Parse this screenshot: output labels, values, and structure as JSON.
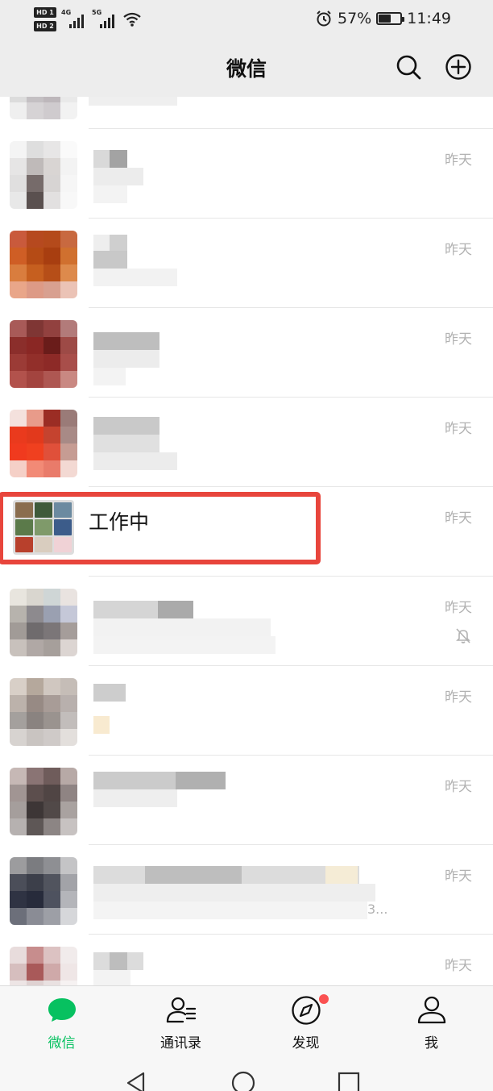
{
  "status_bar": {
    "hd1": "HD 1",
    "hd2": "HD 2",
    "net1": "4G",
    "net2": "5G",
    "battery": "57%",
    "time": "11:49",
    "battery_level": 0.57
  },
  "header": {
    "title": "微信",
    "search_icon": "search-icon",
    "add_icon": "plus-circle-icon"
  },
  "chats": [
    {
      "time": "",
      "name": ""
    },
    {
      "time": "昨天",
      "name": ""
    },
    {
      "time": "昨天",
      "name": ""
    },
    {
      "time": "昨天",
      "name": ""
    },
    {
      "time": "昨天",
      "name": ""
    },
    {
      "time": "昨天",
      "name": "工作中"
    },
    {
      "time": "昨天",
      "name": "",
      "muted": true
    },
    {
      "time": "昨天",
      "name": ""
    },
    {
      "time": "昨天",
      "name": ""
    },
    {
      "time": "昨天",
      "name": "",
      "preview_tail": "3..."
    },
    {
      "time": "昨天",
      "name": ""
    }
  ],
  "bottom_nav": {
    "items": [
      {
        "label": "微信",
        "icon": "chat-bubble-icon",
        "active": true
      },
      {
        "label": "通讯录",
        "icon": "contacts-icon",
        "active": false
      },
      {
        "label": "发现",
        "icon": "compass-icon",
        "active": false,
        "badge": true
      },
      {
        "label": "我",
        "icon": "person-icon",
        "active": false
      }
    ]
  },
  "colors": {
    "accent_green": "#07c160",
    "highlight_red": "#e8453c",
    "badge_red": "#fa5151",
    "time_gray": "#b2b2b2",
    "bar_bg": "#ededed"
  }
}
